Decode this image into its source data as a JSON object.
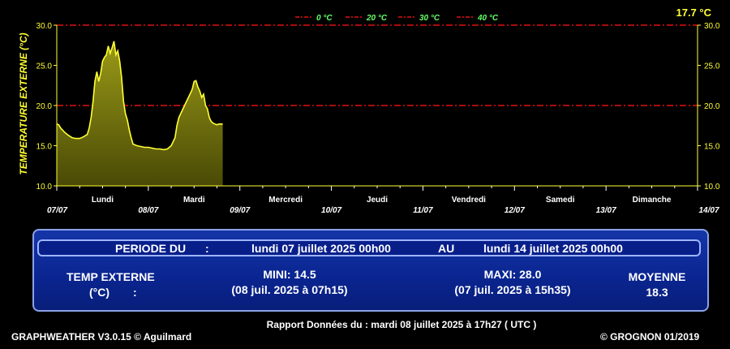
{
  "chart_data": {
    "type": "area",
    "ylabel": "TEMPERATURE EXTERNE (°C)",
    "current_reading": "17.7 °C",
    "ylim": [
      10,
      30
    ],
    "y_ticks": [
      "10.0",
      "15.0",
      "20.0",
      "25.0",
      "30.0"
    ],
    "x_range_hours": [
      0,
      168
    ],
    "date_ticks": [
      "07/07",
      "08/07",
      "09/07",
      "10/07",
      "11/07",
      "12/07",
      "13/07",
      "14/07"
    ],
    "day_labels": [
      "Lundi",
      "Mardi",
      "Mercredi",
      "Jeudi",
      "Vendredi",
      "Samedi",
      "Dimanche"
    ],
    "legend": [
      {
        "label": "0 °C",
        "value": 0
      },
      {
        "label": "20 °C",
        "value": 20
      },
      {
        "label": "30 °C",
        "value": 30
      },
      {
        "label": "40 °C",
        "value": 40
      }
    ],
    "legend_placement": "top-center",
    "colors": {
      "line": "#ffff33",
      "fill": "#7a7a10",
      "threshold": "#e01010",
      "axis_text": "#ffff33",
      "legend_text": "#66ff66"
    },
    "series": [
      {
        "x": [
          0,
          0.5,
          1,
          2,
          3,
          4,
          5,
          6,
          7,
          8,
          8.5,
          9,
          9.5,
          10,
          10.5,
          11,
          11.5,
          12,
          12.5,
          13,
          13.5,
          14,
          14.5,
          15,
          15.5,
          16,
          16.5,
          17,
          17.5,
          18,
          18.5,
          19,
          19.5,
          20,
          21,
          22,
          23,
          24,
          25,
          26,
          27,
          28,
          29,
          30,
          31,
          31.5,
          32,
          33,
          34,
          35,
          35.5,
          36,
          36.5,
          37,
          37.5,
          38,
          38.5,
          39,
          39.5,
          40,
          40.5,
          41,
          41.5,
          42,
          42.5,
          43,
          43.5
        ],
        "values": [
          17.7,
          17.6,
          17.2,
          16.7,
          16.3,
          16.0,
          15.9,
          15.9,
          16.1,
          16.4,
          17.2,
          18.5,
          20.5,
          23.0,
          24.2,
          23.0,
          24.0,
          25.5,
          26.0,
          26.3,
          27.4,
          26.5,
          27.2,
          28.0,
          26.3,
          26.8,
          25.5,
          23.5,
          20.5,
          19.0,
          18.2,
          17.0,
          16.0,
          15.2,
          15.0,
          14.9,
          14.8,
          14.8,
          14.7,
          14.6,
          14.6,
          14.5,
          14.6,
          15.0,
          16.0,
          17.5,
          18.5,
          19.5,
          20.5,
          21.5,
          22.0,
          23.0,
          23.1,
          22.3,
          21.8,
          21.0,
          21.4,
          20.0,
          19.6,
          18.5,
          18.0,
          17.8,
          17.7,
          17.6,
          17.7,
          17.7,
          17.7
        ]
      }
    ]
  },
  "panel": {
    "period_label": "PERIODE DU",
    "colon": ":",
    "period_start": "lundi 07 juillet 2025 00h00",
    "au": "AU",
    "period_end": "lundi 14 juillet 2025 00h00",
    "metric_line1": "TEMP EXTERNE",
    "metric_unit": "(°C)",
    "metric_colon": ":",
    "mini_label": "MINI:  14.5",
    "mini_time": "(08 juil. 2025 à 07h15)",
    "maxi_label": "MAXI:  28.0",
    "maxi_time": "(07 juil. 2025 à 15h35)",
    "moyenne_label": "MOYENNE",
    "moyenne_value": "18.3"
  },
  "footer": {
    "left": "GRAPHWEATHER V3.0.15 © Aguilmard",
    "center": "Rapport Données du :  mardi 08 juillet 2025 à 17h27 ( UTC )",
    "right": "© GROGNON 01/2019"
  }
}
